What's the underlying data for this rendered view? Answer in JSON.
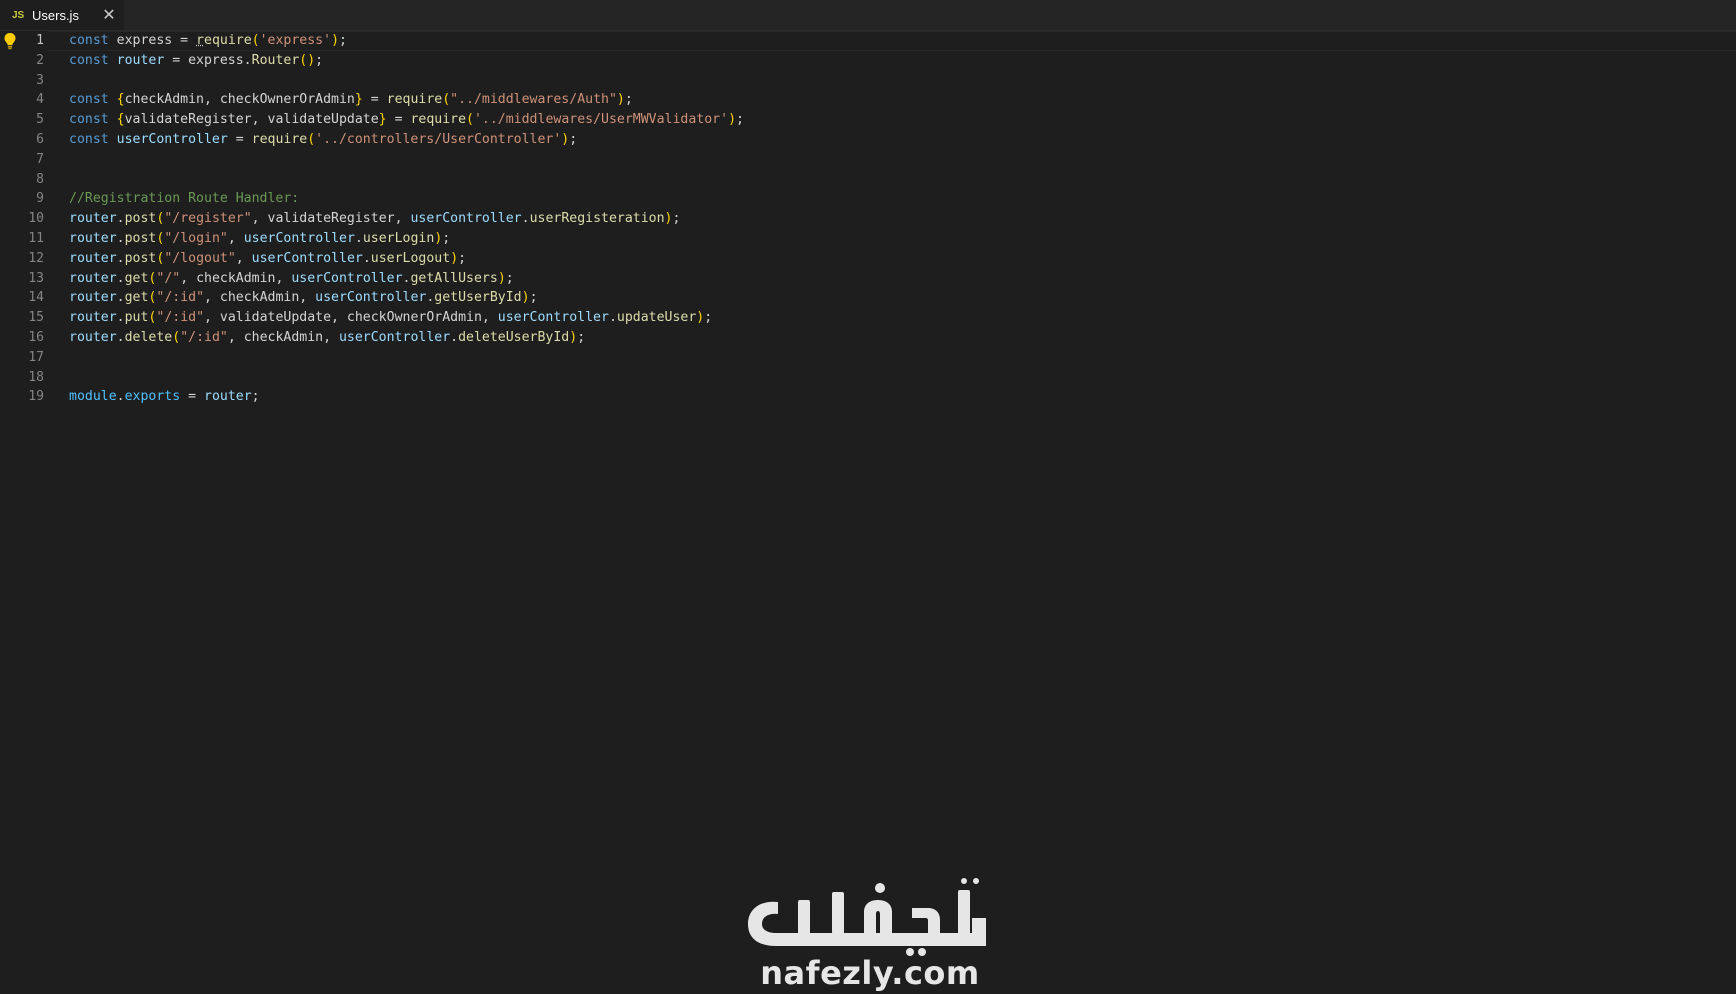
{
  "tab": {
    "icon_text": "JS",
    "icon": "javascript-file-icon",
    "label": "Users.js",
    "close_icon": "close-icon",
    "close_glyph": "✕"
  },
  "editor": {
    "active_line": 1,
    "line_numbers": [
      "1",
      "2",
      "3",
      "4",
      "5",
      "6",
      "7",
      "8",
      "9",
      "10",
      "11",
      "12",
      "13",
      "14",
      "15",
      "16",
      "17",
      "18",
      "19"
    ],
    "lightbulb_icon": "lightbulb-icon",
    "lines": [
      [
        [
          "kw",
          "const "
        ],
        [
          "pl",
          "express = "
        ],
        [
          "squig",
          "r"
        ],
        [
          "fn",
          "equire"
        ],
        [
          "br",
          "("
        ],
        [
          "str",
          "'express'"
        ],
        [
          "br",
          ")"
        ],
        [
          "pl",
          ";"
        ]
      ],
      [
        [
          "kw",
          "const "
        ],
        [
          "var",
          "router"
        ],
        [
          "pl",
          " = express."
        ],
        [
          "fn",
          "Router"
        ],
        [
          "br",
          "()"
        ],
        [
          "pl",
          ";"
        ]
      ],
      [],
      [
        [
          "kw",
          "const "
        ],
        [
          "br",
          "{"
        ],
        [
          "pl",
          "checkAdmin, checkOwnerOrAdmin"
        ],
        [
          "br",
          "}"
        ],
        [
          "pl",
          " = "
        ],
        [
          "fn",
          "require"
        ],
        [
          "br",
          "("
        ],
        [
          "str",
          "\"../middlewares/Auth\""
        ],
        [
          "br",
          ")"
        ],
        [
          "pl",
          ";"
        ]
      ],
      [
        [
          "kw",
          "const "
        ],
        [
          "br",
          "{"
        ],
        [
          "pl",
          "validateRegister, validateUpdate"
        ],
        [
          "br",
          "}"
        ],
        [
          "pl",
          " = "
        ],
        [
          "fn",
          "require"
        ],
        [
          "br",
          "("
        ],
        [
          "str",
          "'../middlewares/UserMWValidator'"
        ],
        [
          "br",
          ")"
        ],
        [
          "pl",
          ";"
        ]
      ],
      [
        [
          "kw",
          "const "
        ],
        [
          "var",
          "userController"
        ],
        [
          "pl",
          " = "
        ],
        [
          "fn",
          "require"
        ],
        [
          "br",
          "("
        ],
        [
          "str",
          "'../controllers/UserController'"
        ],
        [
          "br",
          ")"
        ],
        [
          "pl",
          ";"
        ]
      ],
      [],
      [],
      [
        [
          "cm",
          "//Registration Route Handler:"
        ]
      ],
      [
        [
          "var",
          "router"
        ],
        [
          "pl",
          "."
        ],
        [
          "fn",
          "post"
        ],
        [
          "br",
          "("
        ],
        [
          "str",
          "\"/register\""
        ],
        [
          "pl",
          ", validateRegister, "
        ],
        [
          "var",
          "userController"
        ],
        [
          "pl",
          "."
        ],
        [
          "fn",
          "userRegisteration"
        ],
        [
          "br",
          ")"
        ],
        [
          "pl",
          ";"
        ]
      ],
      [
        [
          "var",
          "router"
        ],
        [
          "pl",
          "."
        ],
        [
          "fn",
          "post"
        ],
        [
          "br",
          "("
        ],
        [
          "str",
          "\"/login\""
        ],
        [
          "pl",
          ", "
        ],
        [
          "var",
          "userController"
        ],
        [
          "pl",
          "."
        ],
        [
          "fn",
          "userLogin"
        ],
        [
          "br",
          ")"
        ],
        [
          "pl",
          ";"
        ]
      ],
      [
        [
          "var",
          "router"
        ],
        [
          "pl",
          "."
        ],
        [
          "fn",
          "post"
        ],
        [
          "br",
          "("
        ],
        [
          "str",
          "\"/logout\""
        ],
        [
          "pl",
          ", "
        ],
        [
          "var",
          "userController"
        ],
        [
          "pl",
          "."
        ],
        [
          "fn",
          "userLogout"
        ],
        [
          "br",
          ")"
        ],
        [
          "pl",
          ";"
        ]
      ],
      [
        [
          "var",
          "router"
        ],
        [
          "pl",
          "."
        ],
        [
          "fn",
          "get"
        ],
        [
          "br",
          "("
        ],
        [
          "str",
          "\"/\""
        ],
        [
          "pl",
          ", checkAdmin, "
        ],
        [
          "var",
          "userController"
        ],
        [
          "pl",
          "."
        ],
        [
          "fn",
          "getAllUsers"
        ],
        [
          "br",
          ")"
        ],
        [
          "pl",
          ";"
        ]
      ],
      [
        [
          "var",
          "router"
        ],
        [
          "pl",
          "."
        ],
        [
          "fn",
          "get"
        ],
        [
          "br",
          "("
        ],
        [
          "str",
          "\"/:id\""
        ],
        [
          "pl",
          ", checkAdmin, "
        ],
        [
          "var",
          "userController"
        ],
        [
          "pl",
          "."
        ],
        [
          "fn",
          "getUserById"
        ],
        [
          "br",
          ")"
        ],
        [
          "pl",
          ";"
        ]
      ],
      [
        [
          "var",
          "router"
        ],
        [
          "pl",
          "."
        ],
        [
          "fn",
          "put"
        ],
        [
          "br",
          "("
        ],
        [
          "str",
          "\"/:id\""
        ],
        [
          "pl",
          ", validateUpdate, checkOwnerOrAdmin, "
        ],
        [
          "var",
          "userController"
        ],
        [
          "pl",
          "."
        ],
        [
          "fn",
          "updateUser"
        ],
        [
          "br",
          ")"
        ],
        [
          "pl",
          ";"
        ]
      ],
      [
        [
          "var",
          "router"
        ],
        [
          "pl",
          "."
        ],
        [
          "fn",
          "delete"
        ],
        [
          "br",
          "("
        ],
        [
          "str",
          "\"/:id\""
        ],
        [
          "pl",
          ", checkAdmin, "
        ],
        [
          "var",
          "userController"
        ],
        [
          "pl",
          "."
        ],
        [
          "fn",
          "deleteUserById"
        ],
        [
          "br",
          ")"
        ],
        [
          "pl",
          ";"
        ]
      ],
      [],
      [],
      [
        [
          "var2",
          "module"
        ],
        [
          "pl",
          "."
        ],
        [
          "var2",
          "exports"
        ],
        [
          "pl",
          " = "
        ],
        [
          "var",
          "router"
        ],
        [
          "pl",
          ";"
        ]
      ]
    ]
  },
  "watermark": {
    "logo_text": "نفذلي",
    "text": "nafezly.com",
    "color": "#e6e6e6"
  },
  "colors": {
    "background": "#1e1e1e",
    "keyword": "#569cd6",
    "variable": "#9cdcfe",
    "function": "#dcdcaa",
    "string": "#ce9178",
    "comment": "#6a9955",
    "bracket": "#ffd700"
  }
}
